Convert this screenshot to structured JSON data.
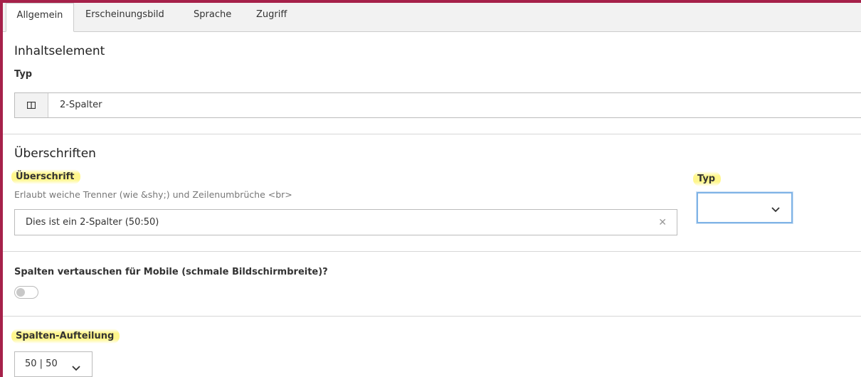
{
  "tabs": [
    {
      "label": "Allgemein",
      "active": true
    },
    {
      "label": "Erscheinungsbild",
      "active": false
    },
    {
      "label": "Sprache",
      "active": false
    },
    {
      "label": "Zugriff",
      "active": false
    }
  ],
  "content_element": {
    "heading": "Inhaltselement",
    "type_label": "Typ",
    "type_value": "2-Spalter",
    "type_icon": "two-column-icon"
  },
  "headers": {
    "heading": "Überschriften",
    "header_label": "Überschrift",
    "header_help": "Erlaubt weiche Trenner (wie &shy;) und Zeilenumbrüche <br>",
    "header_value": "Dies ist ein 2-Spalter (50:50)",
    "header_type_label": "Typ",
    "header_type_value": ""
  },
  "mobile_swap": {
    "label": "Spalten vertauschen für Mobile (schmale Bildschirmbreite)?",
    "checked": false
  },
  "column_split": {
    "label": "Spalten-Aufteilung",
    "value": "50 | 50"
  },
  "colors": {
    "frame": "#a6214a",
    "highlight": "#fff578",
    "focus_border": "#7fb3e6"
  }
}
